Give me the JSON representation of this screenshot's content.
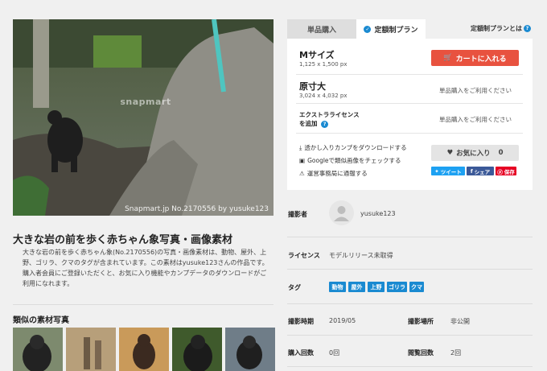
{
  "photo": {
    "watermark_center": "snapmart",
    "watermark_bottom": "Snapmart.jp No.2170556 by yusuke123"
  },
  "title": "大きな岩の前を歩く赤ちゃん象写真・画像素材",
  "description": "大きな岩の前を歩く赤ちゃん象(No.2170556)の写真・画像素材は、動物、屋外、上野、ゴリラ、クマのタグが含まれています。この素材はyusuke123さんの作品です。購入者会員にご登録いただくと、お気に入り機能やカンプデータのダウンロードがご利用になれます。",
  "similar_title": "類似の素材写真",
  "tabs": {
    "buy": "単品購入",
    "plan": "定額制プラン"
  },
  "plan_link": "定額制プランとは",
  "sizes": [
    {
      "name": "Mサイズ",
      "px": "1,125 x 1,500 px"
    },
    {
      "name": "原寸大",
      "px": "3,024 x 4,032 px"
    }
  ],
  "cart_button": "カートに入れる",
  "single_purchase_note": "単品購入をご利用ください",
  "extended_license": {
    "line1": "エクストラライセンス",
    "line2": "を追加"
  },
  "links": {
    "download_comp": "透かし入りカンプをダウンロードする",
    "google_check": "Googleで類似画像をチェックする",
    "report": "運営事務局に通報する"
  },
  "favorite": {
    "label": "お気に入り",
    "count": "0"
  },
  "share": {
    "tweet": "ツイート",
    "facebook": "シェア",
    "pinterest": "保存"
  },
  "info": {
    "photographer_label": "撮影者",
    "photographer": "yusuke123",
    "license_label": "ライセンス",
    "license": "モデルリリース未取得",
    "tags_label": "タグ",
    "tags": [
      "動物",
      "屋外",
      "上野",
      "ゴリラ",
      "クマ"
    ],
    "shoot_date_label": "撮影時期",
    "shoot_date": "2019/05",
    "location_label": "撮影場所",
    "location": "非公開",
    "purchase_label": "購入回数",
    "purchase_count": "0回",
    "views_label": "閲覧回数",
    "views": "2回"
  },
  "colors": {
    "accent_blue": "#1a8ad1",
    "cart_red": "#e8523f"
  }
}
